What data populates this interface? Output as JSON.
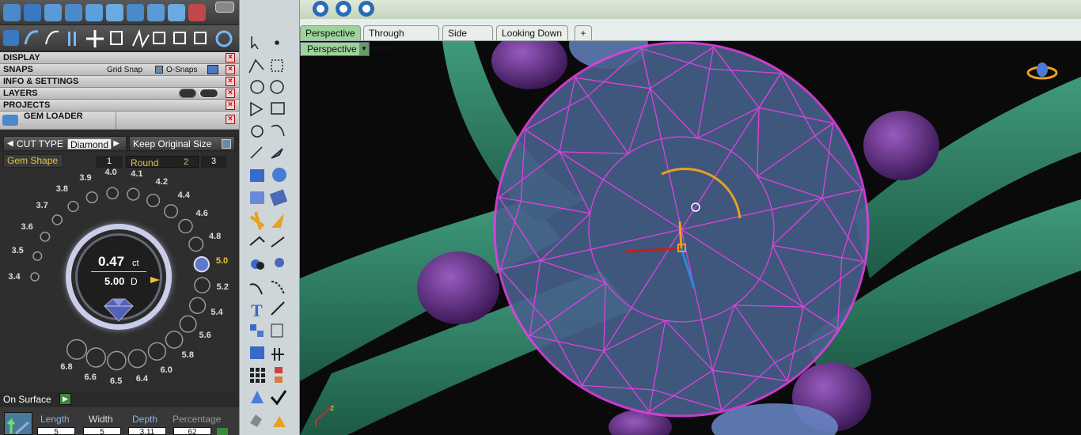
{
  "panels": {
    "display": "DISPLAY",
    "snaps": "SNAPS",
    "grid_snap": "Grid Snap",
    "o_snaps": "O-Snaps",
    "info_settings": "INFO & SETTINGS",
    "layers": "LAYERS",
    "projects": "PROJECTS",
    "gem_loader": "GEM LOADER",
    "close_glyph": "×"
  },
  "gem": {
    "cut_type_label": "CUT TYPE",
    "cut_type_value": "Diamond",
    "keep_original_size": "Keep Original Size",
    "gem_shape_label": "Gem Shape",
    "shape_1": "1",
    "shape_round": "Round",
    "shape_2": "2",
    "shape_3": "3",
    "carat_value": "0.47",
    "carat_unit": "ct",
    "diameter_value": "5.00",
    "diameter_unit": "D",
    "selected_size": "5.0",
    "sizes": [
      "3.4",
      "3.5",
      "3.6",
      "3.7",
      "3.8",
      "3.9",
      "4.0",
      "4.1",
      "4.2",
      "4.4",
      "4.6",
      "4.8",
      "5.0",
      "5.2",
      "5.4",
      "5.6",
      "5.8",
      "6.0",
      "6.4",
      "6.5",
      "6.6",
      "6.8"
    ]
  },
  "bottom": {
    "on_surface": "On Surface",
    "col_length": "Length",
    "col_width": "Width",
    "col_depth": "Depth",
    "col_percentage": "Percentage",
    "val_length": "5",
    "val_width": "5",
    "val_depth": "3.11",
    "val_percentage": "62"
  },
  "viewport": {
    "tabs": [
      "Perspective",
      "Through Finger",
      "Side View",
      "Looking Down"
    ],
    "add_tab": "+",
    "view_name": "Perspective",
    "axis_z": "z"
  },
  "colors": {
    "accent_green": "#9ed39a",
    "gem_outline": "#e040e0",
    "band_green": "#2e7a62",
    "prong_purple": "#6a2f8a",
    "selected_size": "#e8c040"
  }
}
